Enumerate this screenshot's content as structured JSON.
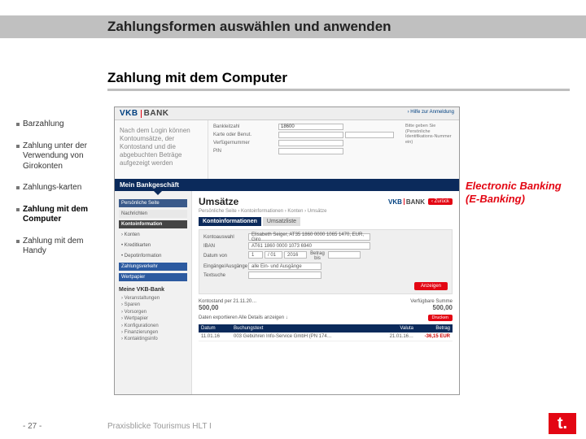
{
  "title": "Zahlungsformen auswählen und anwenden",
  "subtitle": "Zahlung mit dem Computer",
  "sidebar": {
    "items": [
      "Barzahlung",
      "Zahlung unter der Verwendung von Girokonten",
      "Zahlungs-karten",
      "Zahlung mit dem Computer",
      "Zahlung mit dem Handy"
    ]
  },
  "bank": {
    "brand1": "VKB",
    "brand2": "BANK",
    "help": "› Hilfe zur Anmeldung",
    "login_note": "Nach dem Login können Kontoumsätze, der Kontostand und die abgebuchten Beträge aufgezeigt werden",
    "fields": {
      "bank_label": "Bankleitzahl",
      "bank_value": "18600",
      "card_label": "Karte oder Benut.",
      "pin_label": "Verfügernummer",
      "pin2_label": "PIN"
    },
    "side_note": "Bitte geben Sie (Persönliche Identifikations-Nummer ein)",
    "darkbar": "Mein Bankgeschäft",
    "nav": {
      "i1": "Persönliche Seite",
      "i2": "Nachrichten",
      "head": "Kontoinformation",
      "i3": "› Konten",
      "i4": "• Kreditkarten",
      "i5": "• Depotinformation",
      "i6": "Zahlungsverkehr",
      "i7": "Wertpapier",
      "subhead": "Meine VKB-Bank",
      "s1": "› Veranstaltungen",
      "s2": "› Sparen",
      "s3": "› Vorsorgen",
      "s4": "› Wertpapier",
      "s5": "› Konfigurationen",
      "s6": "› Finanzierungen",
      "s7": "› Kontaktingsinfo"
    },
    "main": {
      "title": "Umsätze",
      "back": "‹ Zurück",
      "subline": "Persönliche Seite › Kontoinformationen › Konten › Umsätze",
      "tab1": "Kontoinformationen",
      "tab2": "Umsatzliste",
      "f_konto_l": "Kontoauswahl",
      "f_konto_v": "Elisabeth Seiger, AT35 1860 0000 1065 1470, EUR, Giro",
      "f_iban_l": "IBAN",
      "f_iban_v": "AT61 1860 0000 1073 6940",
      "f_datum_l": "Datum von",
      "f_d1": "1",
      "f_d2": "/ 01",
      "f_d3": "2016",
      "f_bis": "Betrag bis",
      "f_fil_l": "Eingänge/Ausgänge",
      "f_fil_v": "alle Ein- und Ausgänge",
      "f_text_l": "Textsuche",
      "anzeigen": "Anzeigen",
      "bal_l_label": "Kontostand per 21.11.20…",
      "bal_l_value": "500,00",
      "bal_r_label": "Verfügbare Summe",
      "bal_r_value": "500,00",
      "export": "Daten exportieren   Alle Details anzeigen ↓",
      "print": "Drucken",
      "th1": "Datum",
      "th2": "Buchungstext",
      "th3": "Valuta",
      "th4": "Betrag",
      "tr_d": "11.01.16",
      "tr_t": "003 Gebühren Info-Service GmbH (PN 174…",
      "tr_v": "21.01.16…",
      "tr_b": "-36,15 EUR"
    }
  },
  "annotation": {
    "line1": "Electronic Banking",
    "line2": "(E-Banking)"
  },
  "footer": {
    "page": "- 27 -",
    "source": "Praxisblicke Tourismus HLT I",
    "logo": "t."
  }
}
